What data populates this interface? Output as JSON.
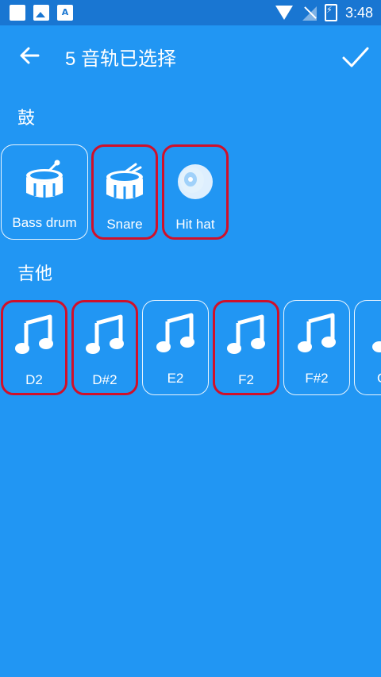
{
  "status_bar": {
    "time": "3:48",
    "badge_a": "A"
  },
  "appbar": {
    "title": "5 音轨已选择"
  },
  "sections": {
    "drums": {
      "label": "鼓",
      "tiles": [
        {
          "label": "Bass drum",
          "selected": false,
          "icon": "drum-icon"
        },
        {
          "label": "Snare",
          "selected": true,
          "icon": "snare-icon"
        },
        {
          "label": "Hit hat",
          "selected": true,
          "icon": "cymbal-icon"
        }
      ]
    },
    "guitar": {
      "label": "吉他",
      "tiles": [
        {
          "label": "D2",
          "selected": true,
          "icon": "music-note-icon"
        },
        {
          "label": "D#2",
          "selected": true,
          "icon": "music-note-icon"
        },
        {
          "label": "E2",
          "selected": false,
          "icon": "music-note-icon"
        },
        {
          "label": "F2",
          "selected": true,
          "icon": "music-note-icon"
        },
        {
          "label": "F#2",
          "selected": false,
          "icon": "music-note-icon"
        },
        {
          "label": "G",
          "selected": false,
          "icon": "music-note-icon"
        }
      ]
    }
  },
  "colors": {
    "background": "#2196F3",
    "statusbar": "#1976D2",
    "selection": "#D0102A",
    "icon": "#FFFFFF"
  }
}
